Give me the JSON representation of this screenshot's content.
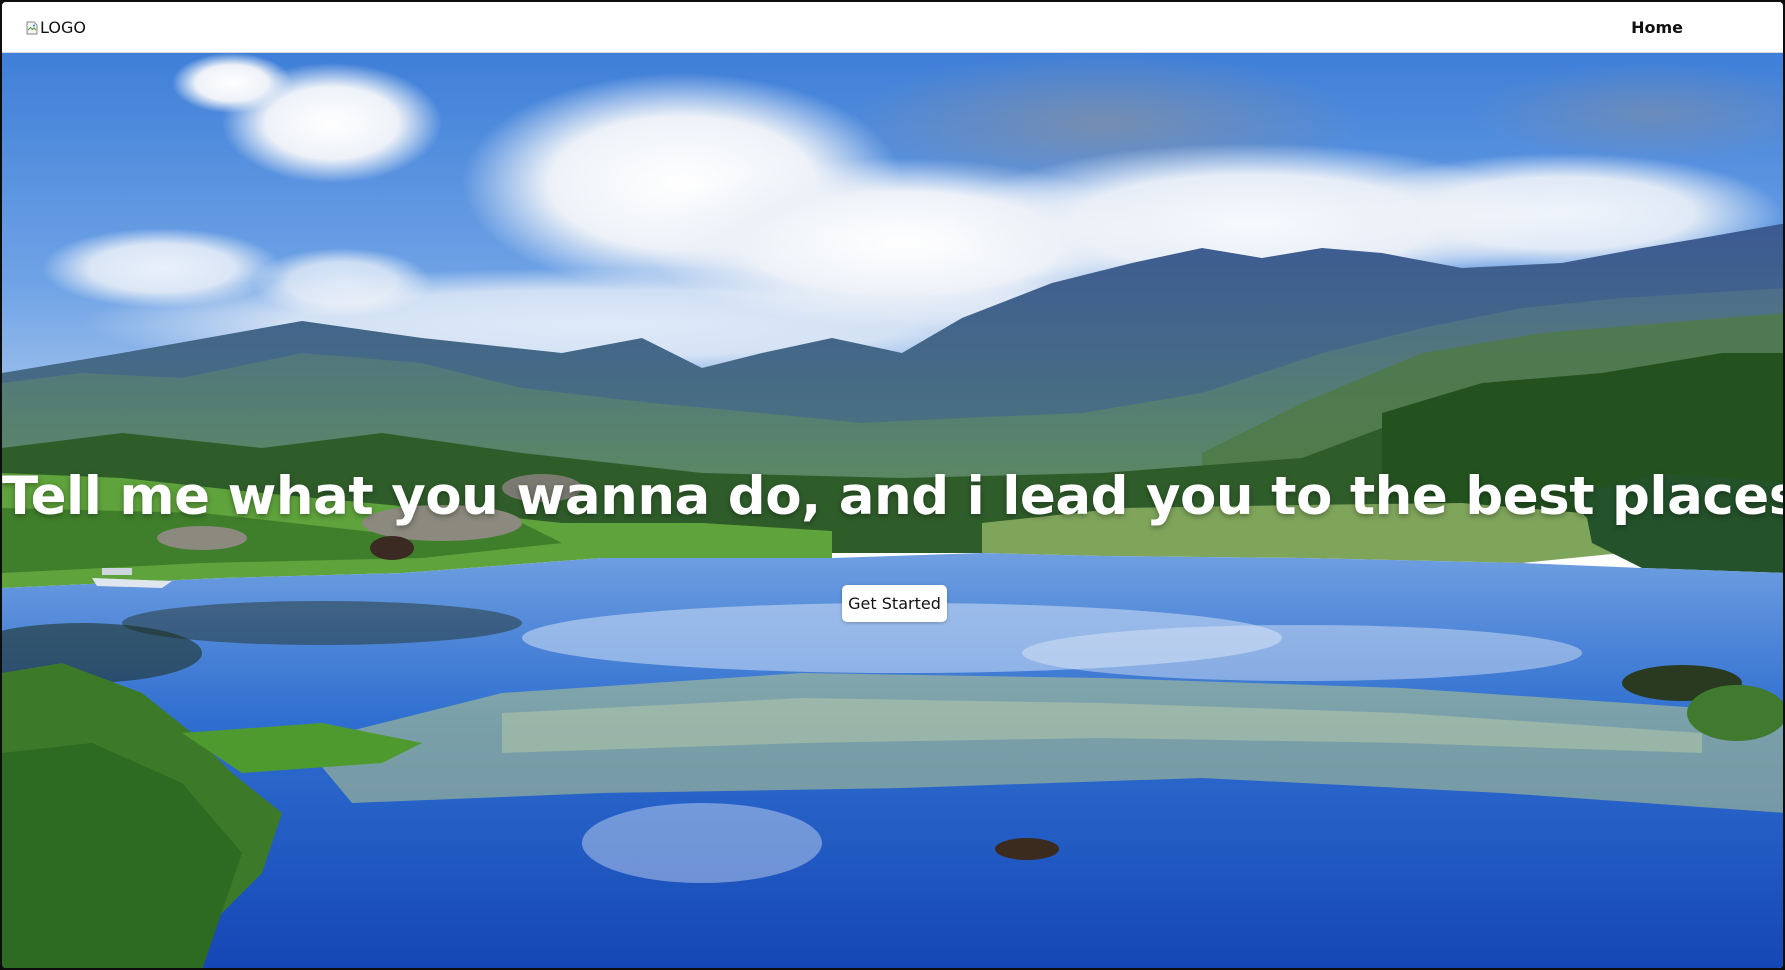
{
  "navbar": {
    "logo_alt": "LOGO",
    "links": [
      {
        "label": "Home"
      }
    ]
  },
  "hero": {
    "title": "Tell me what you wanna do, and i lead you to the best places",
    "cta_label": "Get Started",
    "background_description_icon": "landscape-photo"
  },
  "colors": {
    "navbar_bg": "#ffffff",
    "title_text": "#ffffff",
    "button_bg": "#ffffff",
    "button_text": "#111111"
  }
}
